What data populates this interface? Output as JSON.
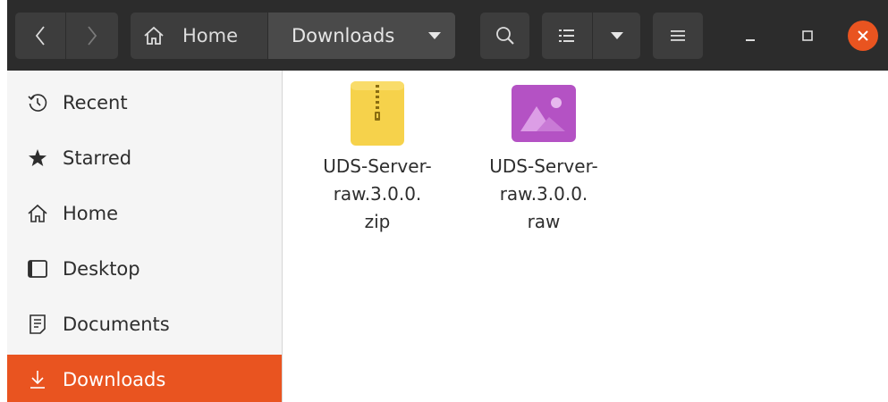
{
  "header": {
    "breadcrumbs": [
      {
        "label": "Home"
      },
      {
        "label": "Downloads"
      }
    ],
    "nav_back_glyph": "‹",
    "nav_forward_glyph": "›"
  },
  "sidebar": {
    "items": [
      {
        "label": "Recent",
        "icon": "clock-icon"
      },
      {
        "label": "Starred",
        "icon": "star-icon"
      },
      {
        "label": "Home",
        "icon": "home-icon"
      },
      {
        "label": "Desktop",
        "icon": "desktop-icon"
      },
      {
        "label": "Documents",
        "icon": "document-icon"
      },
      {
        "label": "Downloads",
        "icon": "download-icon",
        "active": true
      }
    ]
  },
  "files": [
    {
      "name_lines": [
        "UDS-Server-",
        "raw.3.0.0.",
        "zip"
      ],
      "icon": "zip-archive-icon"
    },
    {
      "name_lines": [
        "UDS-Server-",
        "raw.3.0.0.",
        "raw"
      ],
      "icon": "image-file-icon"
    }
  ],
  "colors": {
    "headerbar": "#2c2c2c",
    "accent": "#e95420",
    "zip_icon": "#f6d24b",
    "image_icon": "#b452c4"
  }
}
